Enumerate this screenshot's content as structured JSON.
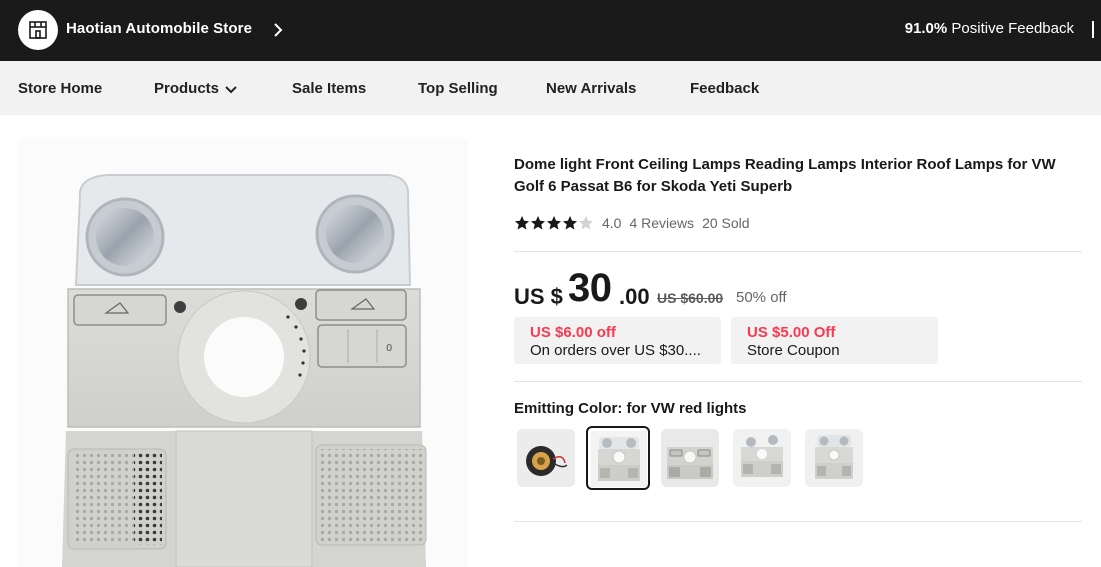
{
  "store": {
    "name": "Haotian Automobile Store",
    "icon": "storefront-icon",
    "feedback_value": "91.0%",
    "feedback_label": "Positive Feedback"
  },
  "nav": {
    "items": [
      "Store Home",
      "Products",
      "Sale Items",
      "Top Selling",
      "New Arrivals",
      "Feedback"
    ]
  },
  "product": {
    "title": "Dome light Front Ceiling Lamps Reading Lamps Interior Roof Lamps for VW Golf 6 Passat B6 for Skoda Yeti Superb",
    "rating": {
      "stars_value": 4.0,
      "score": "4.0",
      "reviews": "4 Reviews",
      "sold": "20 Sold"
    },
    "price": {
      "currency": "US $",
      "integer": "30",
      "decimal": ".00",
      "original": "US $60.00",
      "discount": "50% off"
    },
    "coupons": [
      {
        "title": "US $6.00 off",
        "subtitle": "On orders over US $30...."
      },
      {
        "title": "US $5.00 Off",
        "subtitle": "Store Coupon"
      }
    ],
    "color_label": "Emitting Color: for VW red lights",
    "variants": [
      {
        "name": "coil-bulb",
        "selected": false
      },
      {
        "name": "dome-light-1",
        "selected": true
      },
      {
        "name": "dome-light-2",
        "selected": false
      },
      {
        "name": "dome-light-3",
        "selected": false
      },
      {
        "name": "dome-light-4",
        "selected": false
      }
    ]
  },
  "colors": {
    "header_bg": "#1a1a1a",
    "nav_bg": "#f2f2f2",
    "coupon_red": "#fd384f",
    "star": "#191919"
  }
}
